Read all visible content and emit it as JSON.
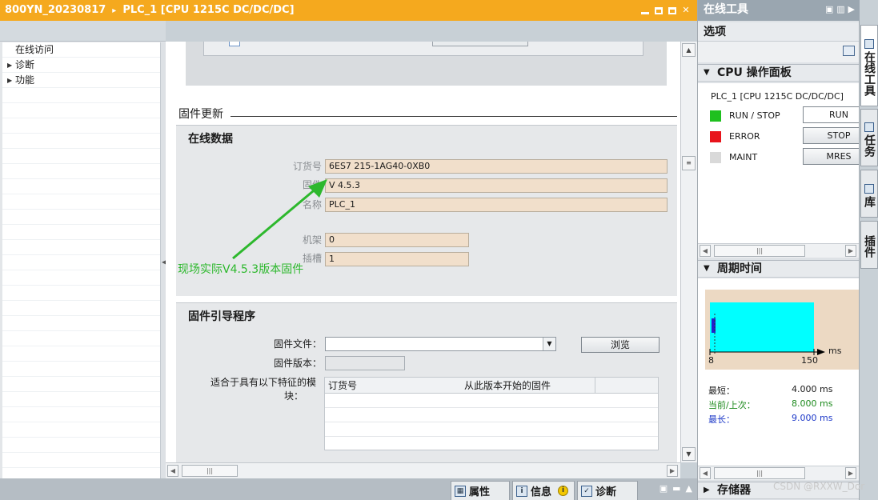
{
  "header": {
    "title": "800YN_20230817",
    "separator": "▸",
    "subtitle": "PLC_1 [CPU 1215C DC/DC/DC]"
  },
  "left_tree": {
    "items": [
      {
        "label": "在线访问",
        "arrow": ""
      },
      {
        "label": "诊断",
        "arrow": "▶"
      },
      {
        "label": "功能",
        "arrow": "▶"
      }
    ]
  },
  "firmware_section": {
    "heading": "固件更新",
    "online_data": {
      "title": "在线数据",
      "order_no_label": "订货号",
      "order_no": "6ES7 215-1AG40-0XB0",
      "firmware_label": "固件",
      "firmware": "V 4.5.3",
      "name_label": "名称",
      "name": "PLC_1",
      "rack_label": "机架",
      "rack": "0",
      "slot_label": "插槽",
      "slot": "1"
    },
    "annotation": "现场实际V4.5.3版本固件",
    "loader": {
      "title": "固件引导程序",
      "file_label": "固件文件：",
      "browse": "浏览",
      "version_label": "固件版本：",
      "suitable_label_1": "适合于具有以下特征的模",
      "suitable_label_2": "块：",
      "col_order": "订货号",
      "col_fw": "从此版本开始的固件"
    }
  },
  "bottom_tabs": {
    "properties": "属性",
    "info": "信息",
    "info_badge": "i",
    "diagnostics": "诊断"
  },
  "right_panel": {
    "header": "在线工具",
    "options": "选项",
    "cpu_section": "CPU 操作面板",
    "cpu_name": "PLC_1 [CPU 1215C DC/DC/DC]",
    "leds": [
      {
        "label": "RUN / STOP",
        "color": "#1fc01f",
        "button": "RUN"
      },
      {
        "label": "ERROR",
        "color": "#e8141b",
        "button": "STOP"
      },
      {
        "label": "MAINT",
        "color": "#d9d9d9",
        "button": "MRES"
      }
    ],
    "cycle_section": "周期时间",
    "cycle_axis": {
      "start": "8",
      "end": "150",
      "unit": "ms"
    },
    "cycle_rows": [
      {
        "label": "最短：",
        "value": "4.000 ms",
        "color": "#1a1a1a"
      },
      {
        "label": "当前/上次：",
        "value": "8.000 ms",
        "color": "#1d8a1d"
      },
      {
        "label": "最长：",
        "value": "9.000 ms",
        "color": "#1c38c8"
      }
    ],
    "storage_section": "存储器"
  },
  "side_tabs": {
    "online_tools": "在线工具",
    "tasks": "任务",
    "library": "库",
    "plugins": "插件"
  },
  "watermark": "CSDN @RXXW_Dor"
}
